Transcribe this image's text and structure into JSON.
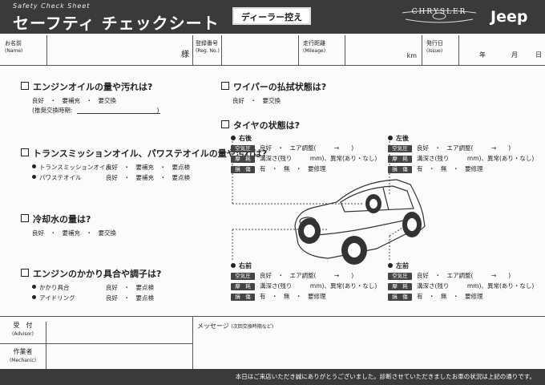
{
  "header": {
    "subtitle": "Safety Check Sheet",
    "title": "セーフティ チェックシート",
    "dealer_copy": "ディーラー控え",
    "brand1": "CHRYSLER",
    "brand2": "Jeep"
  },
  "info": {
    "name_label": "お名前",
    "name_en": "(Name)",
    "sama": "様",
    "reg_label": "登録番号",
    "reg_en": "(Reg. No.)",
    "mileage_label": "走行距離",
    "mileage_en": "(Mileage)",
    "km": "km",
    "issue_label": "発行日",
    "issue_en": "(Issue)",
    "year": "年",
    "month": "月",
    "day": "日"
  },
  "left": {
    "q1": "エンジンオイルの量や汚れは?",
    "q1_opts": "良好　・　要補充　・　要交換",
    "q1_note": "(推奨交換時期:　　　　　　　　　　　　　　)",
    "q2": "トランスミッションオイル、パワステオイルの量や汚れは?",
    "q2_row1_label": "トランスミッションオイル",
    "q2_row1_opts": "良好　・　要補充　・　要点検",
    "q2_row2_label": "パワステオイル",
    "q2_row2_opts": "良好　・　要補充　・　要点検",
    "q3": "冷却水の量は?",
    "q3_opts": "良好　・　要補充　・　要交換",
    "q4": "エンジンのかかり具合や調子は?",
    "q4_row1_label": "かかり具合",
    "q4_row1_opts": "良好　・　要点検",
    "q4_row2_label": "アイドリング",
    "q4_row2_opts": "良好　・　要点検"
  },
  "right": {
    "q5": "ワイパーの払拭状態は?",
    "q5_opts": "良好　・　要交換",
    "q6": "タイヤの状態は?",
    "tires": [
      {
        "name": "右後",
        "r1": "良好　・　エア調整(　　　→　　)",
        "r2": "溝深さ(残り　　　mm)、異常(あり・なし)",
        "r3": "有　・　無　・　要修理"
      },
      {
        "name": "左後",
        "r1": "良好　・　エア調整(　　　→　　)",
        "r2": "溝深さ(残り　　　mm)、異常(あり・なし)",
        "r3": "有　・　無　・　要修理"
      },
      {
        "name": "右前",
        "r1": "良好　・　エア調整(　　　→　　)",
        "r2": "溝深さ(残り　　　mm)、異常(あり・なし)",
        "r3": "有　・　無　・　要修理"
      },
      {
        "name": "左前",
        "r1": "良好　・　エア調整(　　　→　　)",
        "r2": "溝深さ(残り　　　mm)、異常(あり・なし)",
        "r3": "有　・　無　・　要修理"
      }
    ],
    "badge_air": "空気圧",
    "badge_wear": "摩　耗",
    "badge_damage": "損　傷"
  },
  "bottom": {
    "advisor_label": "受　付",
    "advisor_en": "(Advisor)",
    "mechanic_label": "作業者",
    "mechanic_en": "(Mechanic)",
    "message_label": "メッセージ",
    "message_note": "(次回交換時期など)",
    "footer": "本日はご来店いただき誠にありがとうございました。診断させていただきましたお車の状況は上記の通りです。"
  }
}
